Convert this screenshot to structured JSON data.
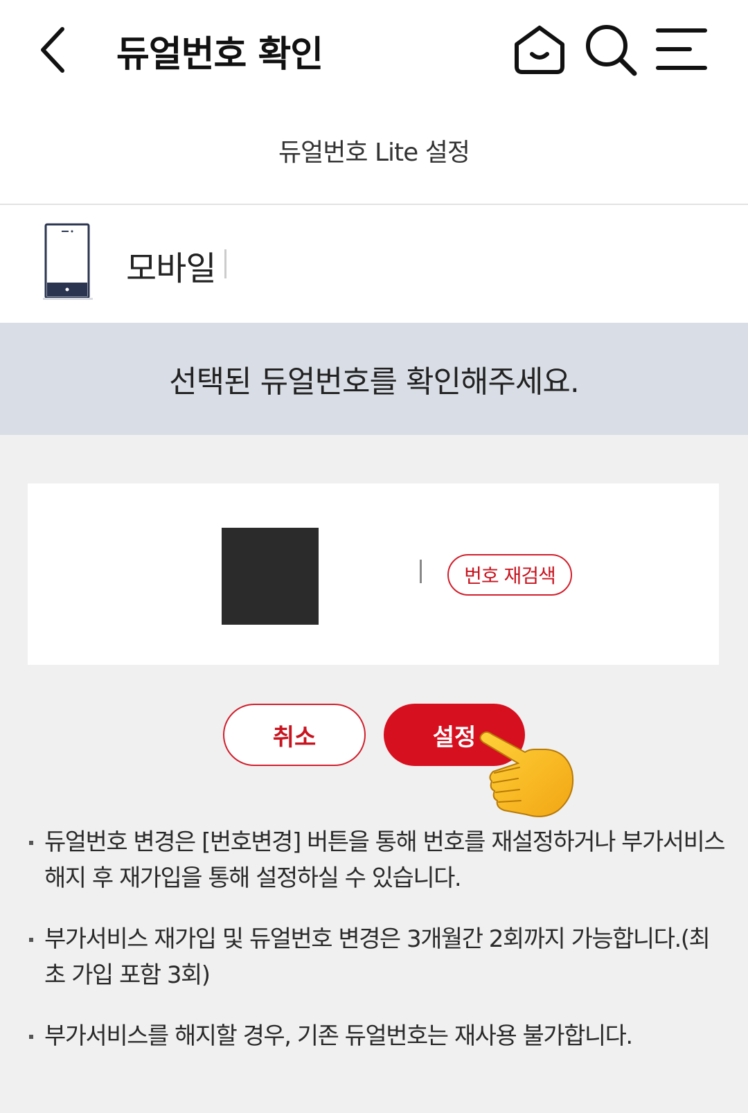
{
  "header": {
    "title": "듀얼번호 확인",
    "icons": [
      "back-icon",
      "home-icon",
      "search-icon",
      "menu-icon"
    ]
  },
  "subheader": {
    "title": "듀얼번호 Lite 설정"
  },
  "device": {
    "label": "모바일",
    "icon": "phone-icon"
  },
  "banner": {
    "text": "선택된 듀얼번호를 확인해주세요."
  },
  "number_card": {
    "research_label": "번호 재검색"
  },
  "actions": {
    "cancel_label": "취소",
    "set_label": "설정"
  },
  "notes": [
    "듀얼번호 변경은 [번호변경] 버튼을 통해 번호를 재설정하거나 부가서비스 해지 후 재가입을 통해 설정하실 수 있습니다.",
    "부가서비스 재가입 및 듀얼번호 변경은 3개월간 2회까지 가능합니다.(최초 가입 포함 3회)",
    "부가서비스를 해지할 경우, 기존 듀얼번호는 재사용 불가합니다."
  ],
  "colors": {
    "accent": "#d7101f",
    "banner_bg": "#d9dee6",
    "page_bg": "#f0f0f0"
  }
}
